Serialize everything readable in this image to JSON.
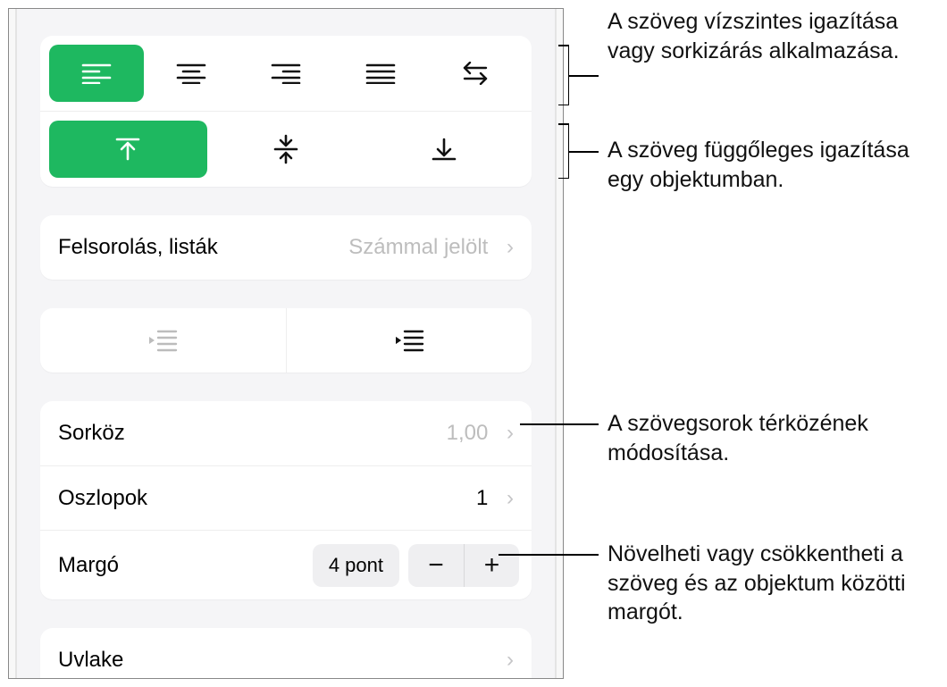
{
  "colors": {
    "accent": "#1eb860"
  },
  "annotations": {
    "horiz": "A szöveg vízszintes igazítása vagy sorkizárás alkalmazása.",
    "vert": "A szöveg függőleges igazítása egy objektumban.",
    "spacing": "A szövegsorok térközének módosítása.",
    "margin": "Növelheti vagy csökkentheti a szöveg és az objektum közötti margót."
  },
  "bullets": {
    "label": "Felsorolás, listák",
    "value": "Számmal jelölt"
  },
  "spacing": {
    "label": "Sorköz",
    "value": "1,00"
  },
  "columns": {
    "label": "Oszlopok",
    "value": "1"
  },
  "margin": {
    "label": "Margó",
    "value": "4 pont"
  },
  "uvlake": {
    "label": "Uvlake"
  },
  "icons": {
    "alignLeft": "align-left-icon",
    "alignCenter": "align-center-icon",
    "alignRight": "align-right-icon",
    "alignJustify": "align-justify-icon",
    "alignAuto": "align-auto-icon",
    "valignTop": "valign-top-icon",
    "valignMiddle": "valign-middle-icon",
    "valignBottom": "valign-bottom-icon",
    "outdent": "outdent-icon",
    "indent": "indent-icon",
    "minus": "minus-icon",
    "plus": "plus-icon",
    "chevron": "chevron-right-icon"
  }
}
